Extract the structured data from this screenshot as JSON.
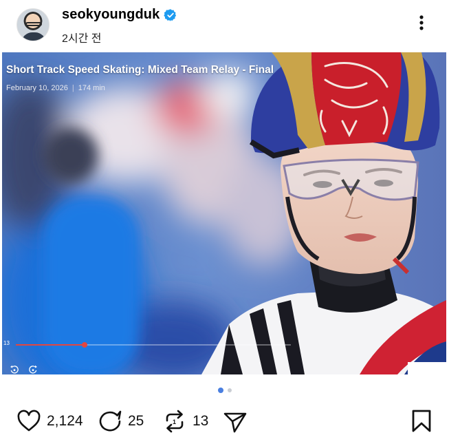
{
  "post": {
    "username": "seokyoungduk",
    "time_ago": "2시간 전",
    "verified": true
  },
  "icons": {
    "verified": "verified-badge-icon",
    "more": "more-vertical-icon",
    "like": "heart-icon",
    "comment": "comment-icon",
    "repost": "repost-icon",
    "share": "send-icon",
    "save": "bookmark-icon",
    "rewind": "rewind-icon",
    "forward": "forward-icon"
  },
  "video": {
    "title": "Short Track Speed Skating: Mixed Team Relay - Final",
    "date": "February 10, 2026",
    "duration": "174 min",
    "current_time": "13",
    "progress": 0.25
  },
  "carousel": {
    "total": 2,
    "active": 0
  },
  "stats": {
    "likes": "2,124",
    "comments": "25",
    "reposts": "13"
  },
  "colors": {
    "verified": "#1d9bf0",
    "progress": "#e4463f",
    "dot_active": "#4a7fe0",
    "dot_inactive": "#c9cdd4"
  }
}
